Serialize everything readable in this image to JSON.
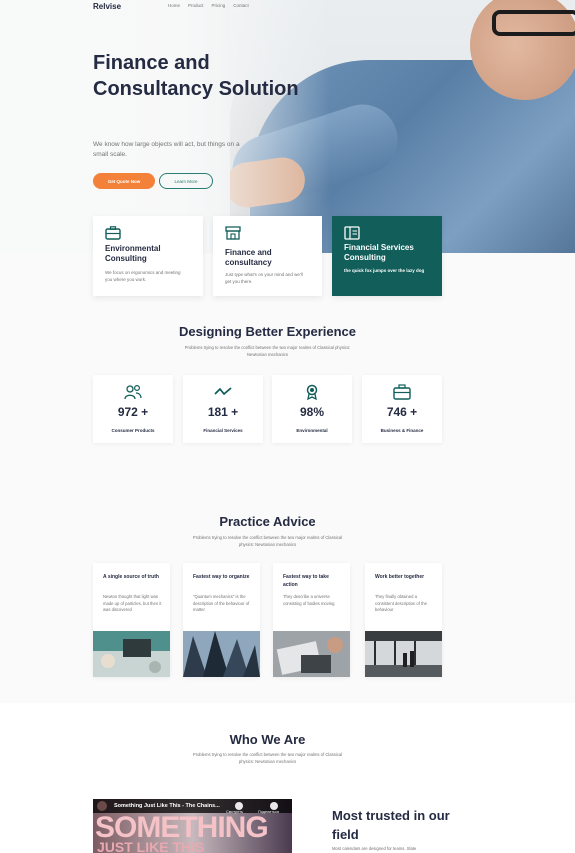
{
  "brand": "Relvise",
  "nav": [
    "Home",
    "Product",
    "Pricing",
    "Contact"
  ],
  "hero": {
    "title": "Finance and Consultancy Solution",
    "subtitle": "We know how large objects will act, but things on a small scale.",
    "primary_button": "Get Quote Now",
    "secondary_button": "Learn More"
  },
  "services": [
    {
      "icon": "briefcase-icon",
      "title": "Environmental Consulting",
      "text": "We focus on ergonomics and meeting you where you work."
    },
    {
      "icon": "shop-icon",
      "title": "Finance and consultancy",
      "text": "Just type what's on your mind and we'll get you there."
    },
    {
      "icon": "book-icon",
      "title": "Financial Services Consulting",
      "text": "the quick fox jumps over the lazy dog"
    }
  ],
  "designing": {
    "title": "Designing Better Experience",
    "subtitle": "Problems trying to resolve the conflict between the two major realms of Classical physics: Newtonian mechanics"
  },
  "stats": [
    {
      "icon": "users-icon",
      "value": "972 +",
      "label": "Consumer Products"
    },
    {
      "icon": "trend-icon",
      "value": "181 +",
      "label": "Financial Services"
    },
    {
      "icon": "award-icon",
      "value": "98%",
      "label": "Environmental"
    },
    {
      "icon": "briefcase-icon",
      "value": "746 +",
      "label": "Business & Finance"
    }
  ],
  "practice": {
    "title": "Practice Advice",
    "subtitle": "Problems trying to resolve the conflict between the two major realms of Classical physics: Newtonian mechanics",
    "cards": [
      {
        "title": "A single source of truth",
        "text": "Newton thought that light was made up of particles, but then it was discovered"
      },
      {
        "title": "Fastest way to organize",
        "text": "\"Quantum mechanics\" is the description of the behaviour of matter"
      },
      {
        "title": "Fastest way to take action",
        "text": "They describe a universe consisting of bodies moving"
      },
      {
        "title": "Work better together",
        "text": "They finally obtained a consistent description of the behaviour"
      }
    ]
  },
  "who": {
    "title": "Who We Are",
    "subtitle": "Problems trying to resolve the conflict between the two major realms of Classical physics: Newtonian mechanics",
    "video_title": "Something Just Like This - The Chains...",
    "video_watch_later": "Смотреть",
    "video_share": "Поделиться",
    "video_big": "SOMETHING",
    "video_big2": "JUST LIKE THIS",
    "trusted_title": "Most trusted in our field",
    "trusted_sub": "Most calendars are designed for teams. Slate"
  },
  "colors": {
    "primary": "#f3813a",
    "teal": "#115e5a",
    "heading": "#252b42",
    "muted": "#737373"
  }
}
